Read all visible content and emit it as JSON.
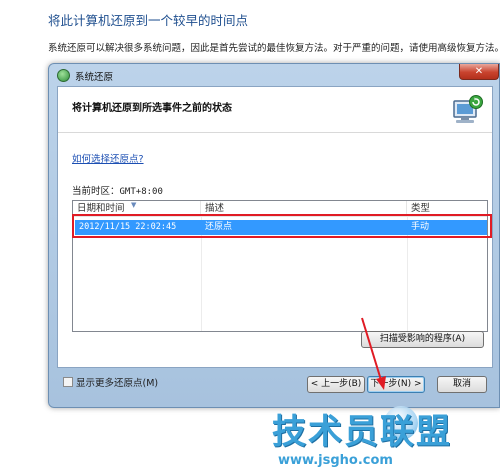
{
  "background": {
    "title": "将此计算机还原到一个较早的时间点",
    "description": "系统还原可以解决很多系统问题，因此是首先尝试的最佳恢复方法。对于严重的问题，请使用高级恢复方法。"
  },
  "dialog": {
    "title": "系统还原",
    "close_label": "✕",
    "header": "将计算机还原到所选事件之前的状态",
    "help_link": "如何选择还原点?",
    "timezone_label": "当前时区：",
    "timezone_value": "GMT+8:00",
    "table": {
      "columns": [
        "日期和时间",
        "描述",
        "类型"
      ],
      "rows": [
        {
          "datetime": "2012/11/15 22:02:45",
          "description": "还原点",
          "type": "手动",
          "selected": true
        }
      ]
    },
    "show_more_label": "显示更多还原点(M)",
    "scan_button": "扫描受影响的程序(A)",
    "back_button": "< 上一步(B)",
    "next_button": "下一步(N) >",
    "cancel_button": "取消"
  },
  "watermark": {
    "text": "技术员联盟",
    "url": "www.jsgho.com"
  },
  "colors": {
    "selection": "#3399ff",
    "annotation_red": "#e01b24",
    "link": "#1c4fb3"
  }
}
